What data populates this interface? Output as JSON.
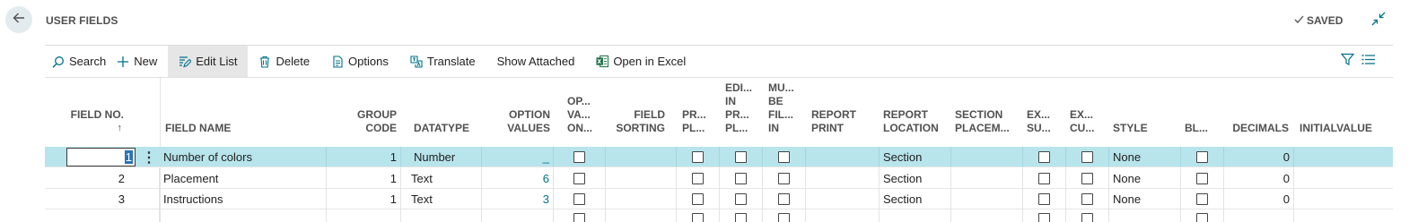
{
  "header": {
    "title": "USER FIELDS",
    "saved_label": "SAVED",
    "back_icon": "arrow-left-icon",
    "collapse_icon": "collapse-icon"
  },
  "toolbar": {
    "search_label": "Search",
    "new_label": "New",
    "edit_list_label": "Edit List",
    "delete_label": "Delete",
    "options_label": "Options",
    "translate_label": "Translate",
    "show_attached_label": "Show Attached",
    "open_excel_label": "Open in Excel"
  },
  "columns": {
    "field_no": "FIELD NO.",
    "field_no_sort": "↑",
    "field_name": "FIELD NAME",
    "group_code_1": "GROUP",
    "group_code_2": "CODE",
    "datatype": "DATATYPE",
    "option_values_1": "OPTION",
    "option_values_2": "VALUES",
    "op_va_on_1": "OP...",
    "op_va_on_2": "VA...",
    "op_va_on_3": "ON...",
    "field_sorting_1": "FIELD",
    "field_sorting_2": "SORTING",
    "pr_pl_1": "PR...",
    "pr_pl_2": "PL...",
    "edi_1": "EDI...",
    "edi_2": "IN",
    "edi_3": "PR...",
    "edi_4": "PL...",
    "mu_1": "MU...",
    "mu_2": "BE",
    "mu_3": "FIL...",
    "mu_4": "IN",
    "report_print_1": "REPORT",
    "report_print_2": "PRINT",
    "report_location_1": "REPORT",
    "report_location_2": "LOCATION",
    "section_placem_1": "SECTION",
    "section_placem_2": "PLACEM...",
    "ex_su_1": "EX...",
    "ex_su_2": "SU...",
    "ex_cu_1": "EX...",
    "ex_cu_2": "CU...",
    "style": "STYLE",
    "bl": "BL...",
    "decimals": "DECIMALS",
    "initialvalue": "INITIALVALUE"
  },
  "rows": [
    {
      "field_no": "1",
      "field_name": "Number of colors",
      "group_code": "1",
      "datatype": "Number",
      "option_values": "_",
      "report_location": "Section",
      "style": "None",
      "decimals": "0"
    },
    {
      "field_no": "2",
      "field_name": "Placement",
      "group_code": "1",
      "datatype": "Text",
      "option_values": "6",
      "report_location": "Section",
      "style": "None",
      "decimals": "0"
    },
    {
      "field_no": "3",
      "field_name": "Instructions",
      "group_code": "1",
      "datatype": "Text",
      "option_values": "3",
      "report_location": "Section",
      "style": "None",
      "decimals": "0"
    }
  ],
  "colors": {
    "selected_row": "#b8e4ec",
    "link": "#00728a",
    "excel_green": "#1e7145",
    "accent_blue": "#2a73b8"
  }
}
